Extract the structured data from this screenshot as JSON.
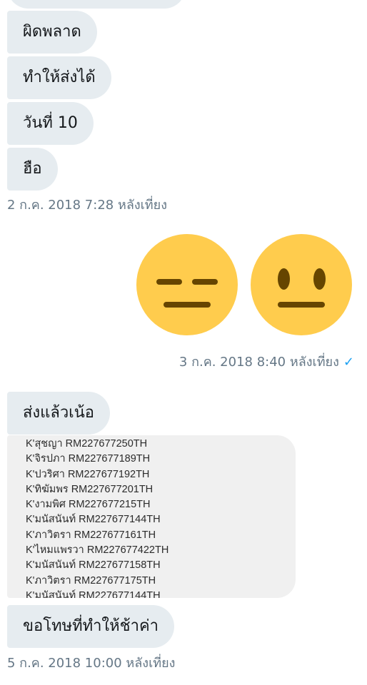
{
  "conversation": {
    "group_1": {
      "messages": [
        "ผิดพลาด",
        "ทำให้ส่งได้",
        "วันที่ 10",
        "ฮือ"
      ],
      "timestamp": "2 ก.ค. 2018 7:28 หลังเที่ยง"
    },
    "sent_emojis": {
      "emojis": [
        "expressionless-face",
        "neutral-face"
      ],
      "timestamp": "3 ก.ค. 2018 8:40 หลังเที่ยง",
      "read_receipt": "✓"
    },
    "group_2": {
      "message": "ส่งแล้วเน้อ",
      "tracking_list": [
        "K'สุชญา RM227677250TH",
        "K'จิรปภา RM227677189TH",
        "K'ปวริศา RM227677192TH",
        "K'ทิฆัมพร RM227677201TH",
        "K'งามพิศ RM227677215TH",
        "K'มนัสนันท์ RM227677144TH",
        "K'ภาวิตรา RM227677161TH",
        "K'ไหมแพรวา RM227677422TH",
        "K'มนัสนันท์ RM227677158TH",
        "K'ภาวิตรา RM227677175TH",
        "K'มนัสนันท์ RM227677144TH"
      ],
      "apology": "ขอโทษที่ทำให้ช้าค่า",
      "timestamp": "5 ก.ค. 2018 10:00 หลังเที่ยง"
    }
  },
  "colors": {
    "bubble_bg": "#e6ecf0",
    "timestamp_text": "#657786",
    "emoji_face": "#ffcc4d",
    "emoji_features": "#664500",
    "read_tick": "#1da1f2"
  }
}
